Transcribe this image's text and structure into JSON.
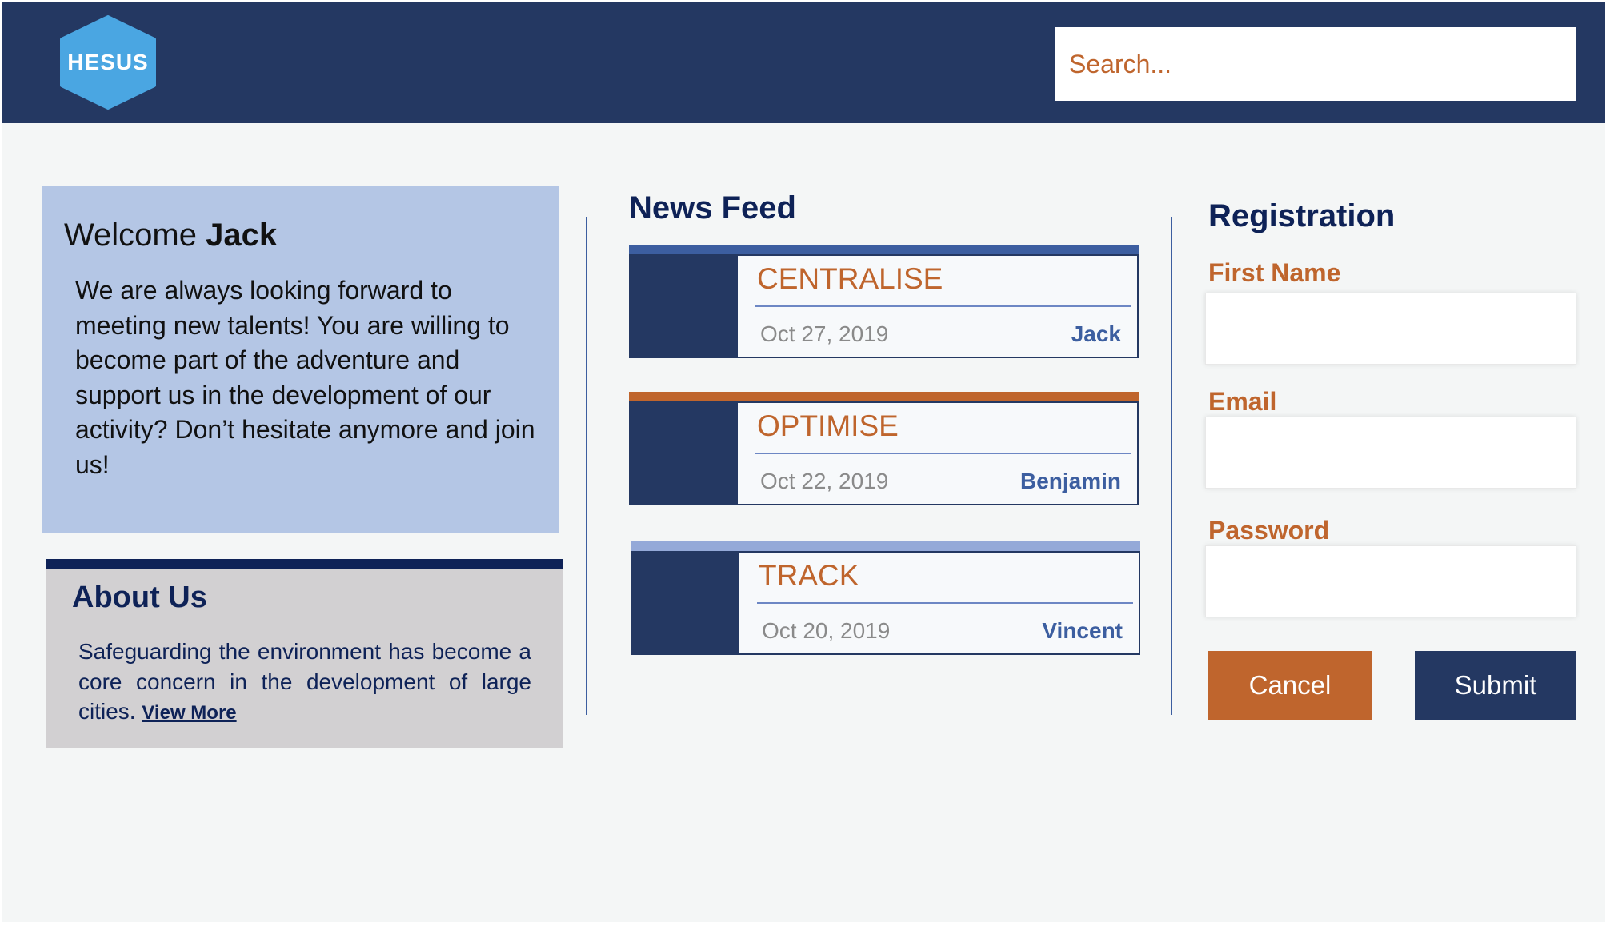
{
  "header": {
    "logo_text": "HESUS",
    "search_placeholder": "Search..."
  },
  "welcome": {
    "greeting": "Welcome",
    "user_name": "Jack",
    "text": "We are always looking forward to meeting new talents! You are willing to become part of the adventure and support us in the development of our activity? Don’t hesitate anymore and join us!"
  },
  "about": {
    "title": "About Us",
    "text": "Safeguarding the environment has become a core concern in the development of large cities.",
    "link_label": "View More"
  },
  "news_feed": {
    "title": "News Feed",
    "items": [
      {
        "title": "CENTRALISE",
        "date": "Oct 27, 2019",
        "author": "Jack",
        "accent_color": "#3c5ea0"
      },
      {
        "title": "OPTIMISE",
        "date": "Oct 22, 2019",
        "author": "Benjamin",
        "accent_color": "#bf652d"
      },
      {
        "title": "TRACK",
        "date": "Oct 20, 2019",
        "author": "Vincent",
        "accent_color": "#94a9d8"
      }
    ]
  },
  "registration": {
    "title": "Registration",
    "first_name_label": "First Name",
    "first_name_value": "",
    "email_label": "Email",
    "email_value": "",
    "password_label": "Password",
    "password_value": "",
    "cancel_label": "Cancel",
    "submit_label": "Submit"
  },
  "colors": {
    "navy": "#243862",
    "dark_navy": "#0e2257",
    "orange": "#bf652d",
    "light_blue": "#b4c6e5",
    "logo_blue": "#4aa6e2",
    "about_bg": "#d2d0d2"
  }
}
